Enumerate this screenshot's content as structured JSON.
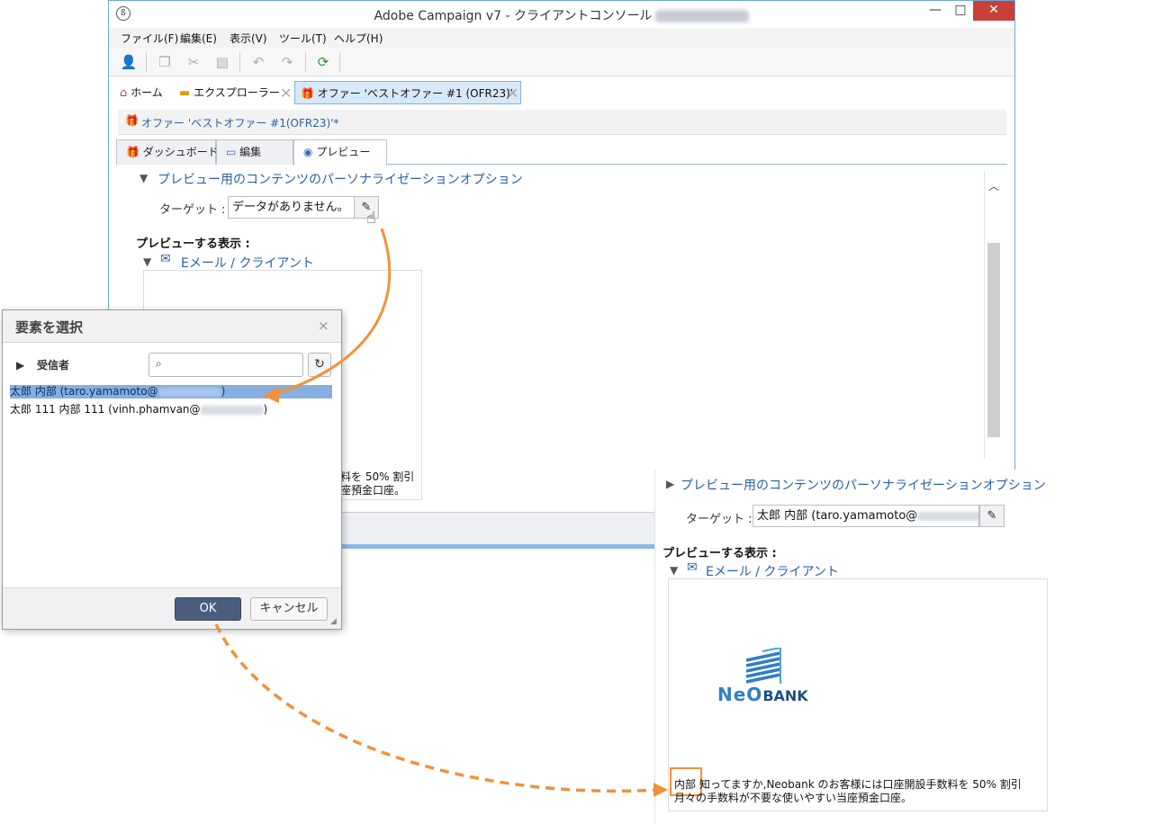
{
  "window": {
    "title": "Adobe Campaign v7 - クライアントコンソール",
    "controls": {
      "minimize": "—",
      "maximize": "□",
      "close": "✕"
    }
  },
  "menu": [
    "ファイル(F)",
    "編集(E)",
    "表示(V)",
    "ツール(T)",
    "ヘルプ(H)"
  ],
  "toolbar_icons": [
    "new-user-icon",
    "copy-icon",
    "cut-icon",
    "paste-icon",
    "undo-icon",
    "redo-icon",
    "refresh-icon"
  ],
  "tabs": [
    {
      "label": "ホーム",
      "icon": "home-icon"
    },
    {
      "label": "エクスプローラー",
      "icon": "folder-icon"
    },
    {
      "label": "オファー 'ベストオファー #1 (OFR23)'",
      "icon": "gift-icon",
      "active": true
    }
  ],
  "docbar": {
    "label": "オファー 'ベストオファー #1(OFR23)'*"
  },
  "subtabs": [
    {
      "label": "ダッシュボード",
      "icon": "gift-icon"
    },
    {
      "label": "編集",
      "icon": "window-icon"
    },
    {
      "label": "プレビュー",
      "icon": "eye-icon",
      "active": true
    }
  ],
  "preview": {
    "section_title": "プレビュー用のコンテンツのパーソナライゼーションオプション",
    "target_label": "ターゲット :",
    "target_value": "データがありません。",
    "display_label": "プレビューする表示 :",
    "email_label": "Eメール / クライアント",
    "partial_line1": "料を 50% 割引",
    "partial_line2": "座預金口座。"
  },
  "dialog": {
    "title": "要素を選択",
    "close": "×",
    "tree_label": "受信者",
    "search_placeholder": "",
    "rows": [
      {
        "name": "太郎 内部 (taro.yamamoto@",
        "suffix": ")",
        "selected": true
      },
      {
        "name": "太郎 111 内部 111 (vinh.phamvan@",
        "suffix": ")",
        "selected": false
      }
    ],
    "ok_label": "OK",
    "cancel_label": "キャンセル"
  },
  "result": {
    "section_title": "プレビュー用のコンテンツのパーソナライゼーションオプション",
    "target_label": "ターゲット :",
    "target_value": "太郎 内部 (taro.yamamoto@",
    "target_suffix": ")",
    "display_label": "プレビューする表示 :",
    "email_label": "Eメール / クライアント",
    "logo_neo": "NeO",
    "logo_bank": "BANK",
    "line1_highlight": "内部",
    "line1_rest": " 知ってますか,Neobank のお客様には口座開設手数料を 50% 割引",
    "line2": "月々の手数料が不要な使いやすい当座預金口座。"
  },
  "colors": {
    "accent_blue": "#2a5fa8",
    "arrow_orange": "#f0913a",
    "selected_row": "#87aede",
    "ok_button": "#4c5e7e",
    "window_border": "#6aa8da",
    "close_red": "#c7403a"
  }
}
